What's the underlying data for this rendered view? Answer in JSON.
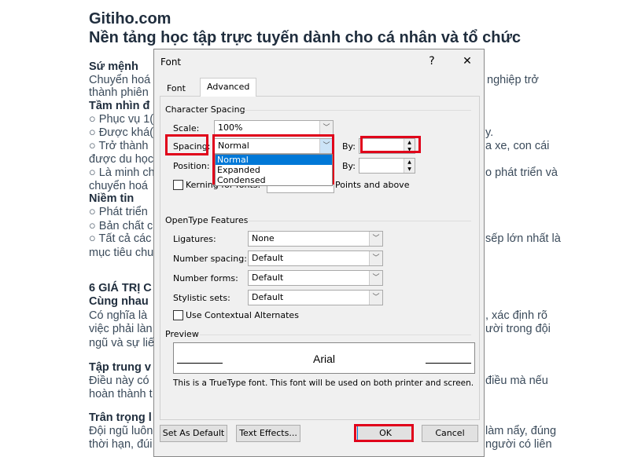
{
  "document": {
    "title": "Gitiho.com",
    "subtitle": "Nền tảng học tập trực tuyến dành cho cá nhân và tổ chức",
    "left_lines": [
      "Sứ mệnh",
      "Chuyển hoá",
      "thành phiên",
      "Tầm nhìn đ",
      "○ Phục vụ 1(",
      "○ Được khá(",
      "○ Trở thành",
      "được du học",
      "○ Là minh ch",
      "chuyển hoá",
      "Niềm tin",
      "○ Phát triển",
      "○ Bản chất c",
      "○ Tất cả các",
      "mục tiêu chu",
      "6 GIÁ TRỊ C",
      "Cùng nhau",
      "Có nghĩa là",
      "việc phải làn",
      "ngũ và sự liế",
      "Tập trung v",
      "Điều này có",
      "hoàn thành t",
      "Trân trọng l",
      "Đội ngũ luôn",
      "thời hạn, đúi"
    ],
    "right_lines": [
      "nghiệp trở",
      "y.",
      "a xe, con cái",
      "o phát triển và",
      "sếp lớn nhất là",
      ", xác định rõ",
      "ười trong đội",
      "điều mà nếu",
      "làm nẩy, đúng",
      "người có liên"
    ]
  },
  "dialog": {
    "title": "Font",
    "help": "?",
    "close": "✕",
    "tabs": [
      "Font",
      "Advanced"
    ],
    "character_spacing": {
      "heading": "Character Spacing",
      "scale_label": "Scale:",
      "scale_value": "100%",
      "spacing_label": "Spacing:",
      "spacing_value": "Normal",
      "spacing_options": [
        "Normal",
        "Expanded",
        "Condensed"
      ],
      "by_label": "By:",
      "position_label": "Position:",
      "kerning_label": "Kerning for fonts:",
      "points_label": "Points and above"
    },
    "opentype": {
      "heading": "OpenType Features",
      "ligatures_label": "Ligatures:",
      "ligatures_value": "None",
      "number_spacing_label": "Number spacing:",
      "number_spacing_value": "Default",
      "number_forms_label": "Number forms:",
      "number_forms_value": "Default",
      "stylistic_label": "Stylistic sets:",
      "stylistic_value": "Default",
      "contextual_label": "Use Contextual Alternates"
    },
    "preview": {
      "heading": "Preview",
      "sample": "Arial",
      "note": "This is a TrueType font. This font will be used on both printer and screen."
    },
    "buttons": {
      "default": "Set As Default",
      "effects": "Text Effects...",
      "ok": "OK",
      "cancel": "Cancel"
    }
  }
}
